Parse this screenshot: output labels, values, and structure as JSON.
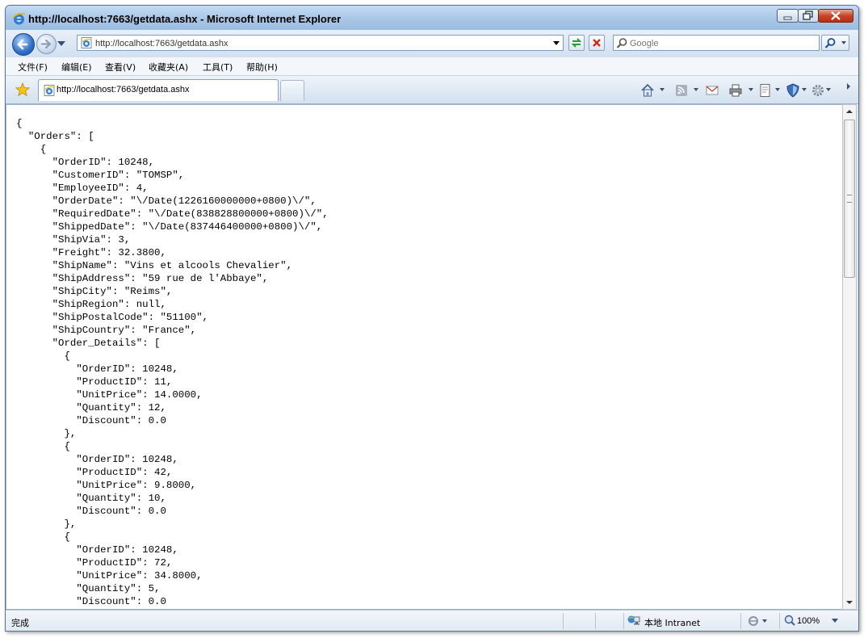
{
  "window": {
    "title": "http://localhost:7663/getdata.ashx - Microsoft Internet Explorer"
  },
  "address": {
    "url": "http://localhost:7663/getdata.ashx"
  },
  "search": {
    "placeholder": "Google"
  },
  "menu": [
    "文件(F)",
    "编辑(E)",
    "查看(V)",
    "收藏夹(A)",
    "工具(T)",
    "帮助(H)"
  ],
  "tab": {
    "label": "http://localhost:7663/getdata.ashx"
  },
  "content": {
    "json_lines": [
      "{",
      "  \"Orders\": [",
      "    {",
      "      \"OrderID\": 10248,",
      "      \"CustomerID\": \"TOMSP\",",
      "      \"EmployeeID\": 4,",
      "      \"OrderDate\": \"\\/Date(1226160000000+0800)\\/\",",
      "      \"RequiredDate\": \"\\/Date(838828800000+0800)\\/\",",
      "      \"ShippedDate\": \"\\/Date(837446400000+0800)\\/\",",
      "      \"ShipVia\": 3,",
      "      \"Freight\": 32.3800,",
      "      \"ShipName\": \"Vins et alcools Chevalier\",",
      "      \"ShipAddress\": \"59 rue de l'Abbaye\",",
      "      \"ShipCity\": \"Reims\",",
      "      \"ShipRegion\": null,",
      "      \"ShipPostalCode\": \"51100\",",
      "      \"ShipCountry\": \"France\",",
      "      \"Order_Details\": [",
      "        {",
      "          \"OrderID\": 10248,",
      "          \"ProductID\": 11,",
      "          \"UnitPrice\": 14.0000,",
      "          \"Quantity\": 12,",
      "          \"Discount\": 0.0",
      "        },",
      "        {",
      "          \"OrderID\": 10248,",
      "          \"ProductID\": 42,",
      "          \"UnitPrice\": 9.8000,",
      "          \"Quantity\": 10,",
      "          \"Discount\": 0.0",
      "        },",
      "        {",
      "          \"OrderID\": 10248,",
      "          \"ProductID\": 72,",
      "          \"UnitPrice\": 34.8000,",
      "          \"Quantity\": 5,",
      "          \"Discount\": 0.0"
    ]
  },
  "status": {
    "text": "完成",
    "zone": "本地 Intranet",
    "zoom": "100%"
  },
  "colors": {
    "title_bar": "#a9c6e6",
    "window_border": "#5a7594",
    "close_button": "#c7452a"
  }
}
